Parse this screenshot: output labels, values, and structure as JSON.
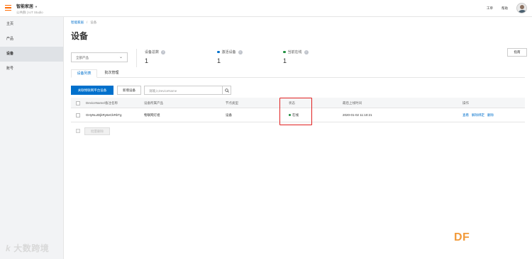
{
  "topbar": {
    "app_name": "智能家居",
    "app_caret": "▼",
    "app_sub": "公共群 | IoT Studio",
    "links": [
      "工单",
      "帮助"
    ]
  },
  "sidebar": {
    "items": [
      {
        "label": "主页",
        "active": false
      },
      {
        "label": "产品",
        "active": false
      },
      {
        "label": "设备",
        "active": true
      },
      {
        "label": "账号",
        "active": false
      }
    ]
  },
  "breadcrumb": {
    "root": "智能家居",
    "sep": "/",
    "current": "设备"
  },
  "page": {
    "title": "设备",
    "docs_button": "指南"
  },
  "product_select": {
    "value": "全部产品",
    "chevron": "⌄"
  },
  "stats": [
    {
      "label": "设备总数",
      "value": "1",
      "dot_color": null
    },
    {
      "label": "激活设备",
      "value": "1",
      "dot_color": "#0070cc"
    },
    {
      "label": "当前在线",
      "value": "1",
      "dot_color": "#1e8e3e"
    }
  ],
  "stat_help_glyph": "?",
  "tabs": [
    {
      "label": "设备列表",
      "active": true
    },
    {
      "label": "批次管理",
      "active": false
    }
  ],
  "toolbar": {
    "primary_button": "关联物联网平台设备",
    "secondary_button": "新增设备",
    "search_placeholder": "请输入DeviceName"
  },
  "table": {
    "headers": [
      "DeviceName/备注名称",
      "设备所属产品",
      "节点类型",
      "状态",
      "最后上线时间",
      "操作"
    ],
    "rows": [
      {
        "device_name": "GHyNuJDjkRy6eCkRbTg",
        "product": "物联网灯组",
        "node_type": "设备",
        "status": "在线",
        "last_online": "2020-01-02 11:10:21",
        "actions": [
          "查看",
          "解除绑定",
          "删除"
        ]
      }
    ]
  },
  "batch_delete": "批量删除",
  "watermarks": {
    "left_logo": "k",
    "left_text": "大数跨境",
    "right_text": "DF"
  },
  "colors": {
    "accent": "#0070cc",
    "brand_orange": "#ff6a00",
    "online": "#1e8e3e",
    "highlight": "#e02020"
  }
}
